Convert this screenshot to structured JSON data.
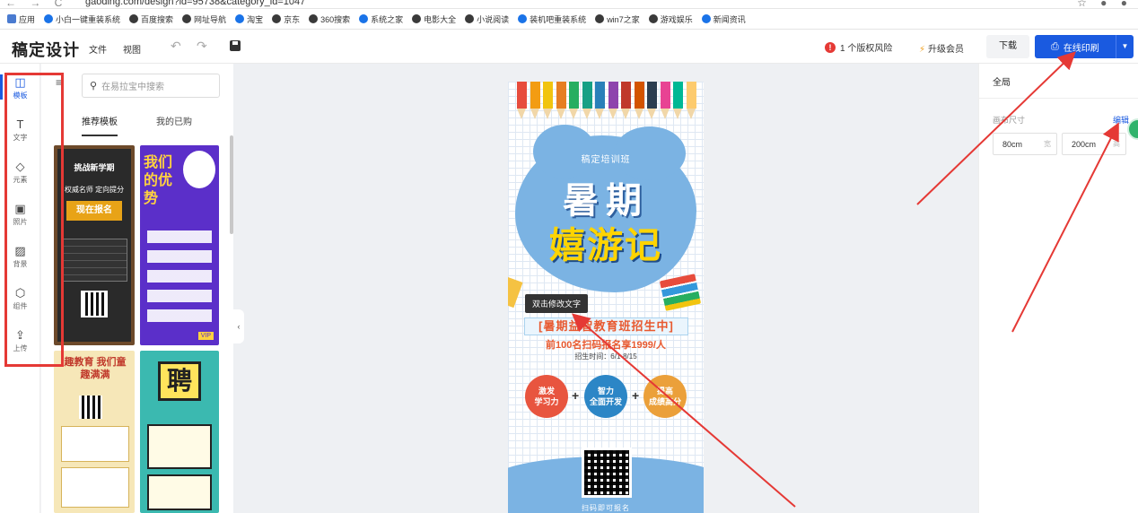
{
  "browser": {
    "url": "gaoding.com/design?id=95738&category_id=1047",
    "bookmarks": [
      "应用",
      "小白一键重装系统",
      "百度搜索",
      "网址导航",
      "淘宝",
      "京东",
      "360搜索",
      "系统之家",
      "电影大全",
      "小说阅读",
      "装机吧重装系统",
      "win7之家",
      "游戏娱乐",
      "新闻资讯"
    ]
  },
  "header": {
    "brand": "稿定设计",
    "menu_file": "文件",
    "menu_view": "视图",
    "risk_count": "!",
    "risk_label": "1 个版权风险",
    "vip_label": "升级会员",
    "download_label": "下载",
    "print_label": "在线印刷"
  },
  "rail": {
    "items": [
      {
        "label": "模板",
        "icon": "layout-icon"
      },
      {
        "label": "文字",
        "icon": "text-icon"
      },
      {
        "label": "元素",
        "icon": "shapes-icon"
      },
      {
        "label": "照片",
        "icon": "image-icon"
      },
      {
        "label": "背景",
        "icon": "stripes-icon"
      },
      {
        "label": "组件",
        "icon": "cube-icon"
      },
      {
        "label": "上传",
        "icon": "upload-icon"
      }
    ]
  },
  "panel": {
    "search_placeholder": "在易拉宝中搜索",
    "tab_recommended": "推荐模板",
    "tab_mine": "我的已购",
    "t1": {
      "line1": "挑战新学期",
      "line2": "权威名师 定向提分",
      "cta": "现在报名"
    },
    "t2": {
      "title": "我们的优势",
      "badge": "VIP"
    },
    "t3": {
      "title": "趣教育 我们童趣满满"
    },
    "t4": {
      "title": "聘"
    }
  },
  "poster": {
    "sub": "稿定培训班",
    "title1": "暑期",
    "title2": "嬉游记",
    "tooltip": "双击修改文字",
    "ribbon": "[暑期益智教育班招生中]",
    "promo": "前100名扫码报名享1999/人",
    "time": "招生时间：6/1-8/15",
    "c1": "激发\n学习力",
    "c2": "智力\n全面开发",
    "c3": "提高\n成绩高分",
    "scan": "扫码即可报名"
  },
  "right_panel": {
    "title": "全局",
    "size_label": "画布尺寸",
    "edit_label": "编辑",
    "width_value": "80cm",
    "width_unit": "宽",
    "height_value": "200cm",
    "height_unit": "高"
  },
  "colors": {
    "accent": "#1a5ae0",
    "annotation": "#e53935",
    "poster_blue": "#7bb3e3"
  }
}
